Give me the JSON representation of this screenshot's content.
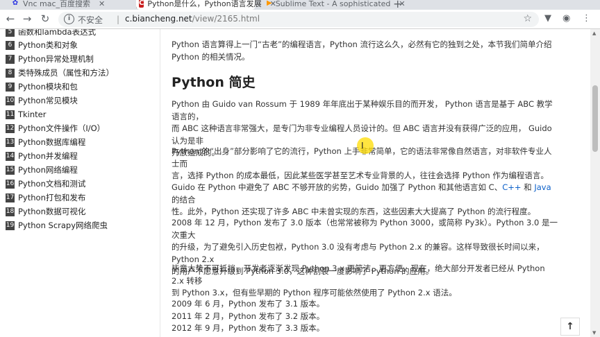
{
  "tabs": [
    {
      "label": "Vnc mac_百度搜索",
      "icon": "paw-icon"
    },
    {
      "label": "Python是什么，Python语言发展",
      "icon": "c-logo-icon",
      "active": true
    },
    {
      "label": "Sublime Text - A sophisticated",
      "icon": "sublime-icon"
    }
  ],
  "new_tab_glyph": "+",
  "address": {
    "insecure_label": "不安全",
    "divider": "|",
    "host": "c.biancheng.net",
    "path": "/view/2165.html"
  },
  "sidebar": {
    "items": [
      {
        "num": "5",
        "label": "函数和lambda表达式"
      },
      {
        "num": "6",
        "label": "Python类和对象"
      },
      {
        "num": "7",
        "label": "Python异常处理机制"
      },
      {
        "num": "8",
        "label": "类特殊成员（属性和方法）"
      },
      {
        "num": "9",
        "label": "Python模块和包"
      },
      {
        "num": "10",
        "label": "Python常见模块"
      },
      {
        "num": "11",
        "label": "Tkinter"
      },
      {
        "num": "12",
        "label": "Python文件操作（I/O）"
      },
      {
        "num": "13",
        "label": "Python数据库编程"
      },
      {
        "num": "14",
        "label": "Python并发编程"
      },
      {
        "num": "15",
        "label": "Python网络编程"
      },
      {
        "num": "16",
        "label": "Python文档和测试"
      },
      {
        "num": "17",
        "label": "Python打包和发布"
      },
      {
        "num": "18",
        "label": "Python数据可视化"
      },
      {
        "num": "19",
        "label": "Python Scrapy网络爬虫"
      }
    ]
  },
  "article": {
    "intro_l1": "Python 语言算得上一门“古老”的编程语言，Python 流行这么久，必然有它的独到之处，本节我们简单介绍",
    "intro_l2": "Python 的相关情况。",
    "heading": "Python 简史",
    "p1_l1": "Python 由 Guido van Rossum 于 1989 年年底出于某种娱乐目的而开发， Python 语言是基于 ABC 教学语言的，",
    "p1_l2": "而 ABC 这种语言非常强大，是专门为非专业编程人员设计的。但 ABC 语言并没有获得广泛的应用， Guido 认为是非",
    "p1_l3": "开放造成的。",
    "p2_l1": "Python 的“出身”部分影响了它的流行，Python 上手非常简单，它的语法非常像自然语言，对非软件专业人士而",
    "p2_l2": "言，选择 Python 的成本最低，因此某些医学甚至艺术专业背景的人，往往会选择 Python 作为编程语言。",
    "p3_l1_a": "Guido 在 Python 中避免了 ABC 不够开放的劣势，Guido 加强了 Python 和其他语言如 C、",
    "p3_link_cpp": "C++",
    "p3_and": " 和 ",
    "p3_link_java": "Java",
    "p3_l1_b": " 的结合",
    "p3_l2": "性。此外，Python 还实现了许多 ABC 中未曾实现的东西，这些因素大大提高了 Python 的流行程度。",
    "p4_l1": "2008 年 12 月，Python 发布了 3.0 版本（也常常被称为 Python 3000，或简称 Py3k）。Python 3.0 是一次重大",
    "p4_l2": "的升级，为了避免引入历史包袱，Python 3.0 没有考虑与 Python 2.x 的兼容。这样导致很长时间以来，Python 2.x",
    "p4_l3": "的用户不愿意升级到 Python 3.0，这种割裂一度影响了 Python 的应用。",
    "p5_l1": "毕竟大势不可抵挡，开发者逐渐发现 Python 3.x 更简洁、更方便。现在，绝大部分开发者已经从 Python 2.x 转移",
    "p5_l2": "到 Python 3.x，但有些早期的 Python 程序可能依然使用了 Python 2.x 语法。",
    "p6_l1": "2009 年 6 月，Python 发布了 3.1 版本。",
    "p6_l2": "2011 年 2 月，Python 发布了 3.2 版本。",
    "p6_l3": "2012 年 9 月，Python 发布了 3.3 版本。"
  },
  "back_to_top_glyph": "↑",
  "colors": {
    "link": "#0c60c9",
    "accent": "#c81e1e"
  }
}
